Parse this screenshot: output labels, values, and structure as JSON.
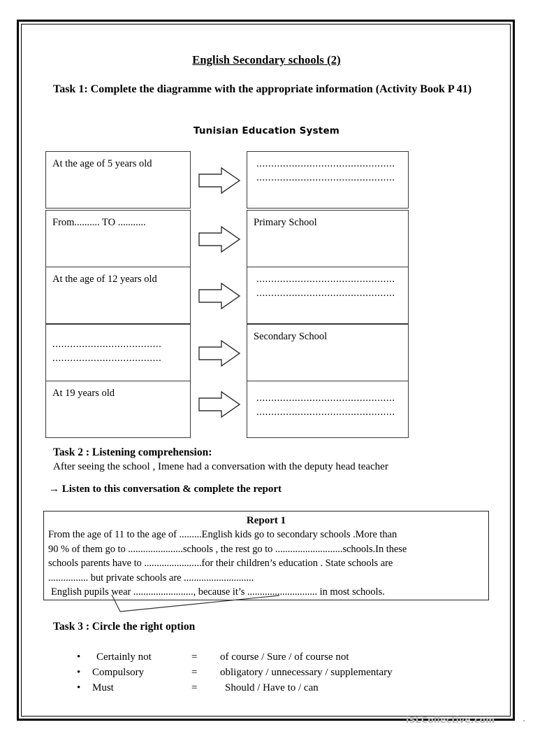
{
  "document": {
    "title": "English Secondary schools (2)",
    "watermark": "iSLCollective.com"
  },
  "task1": {
    "heading": "Task 1: Complete the diagramme with the appropriate information (Activity Book P 41)",
    "diagram_caption": "Tunisian Education System",
    "arrow_icon": "right-arrow-icon",
    "rows": [
      {
        "left": "At the age of 5 years old",
        "left_dots": [],
        "right": "",
        "right_dots": [
          "...............................................",
          "..............................................."
        ]
      },
      {
        "left": "From.......... TO ...........",
        "left_dots": [],
        "right": "Primary School",
        "right_dots": []
      },
      {
        "left": "At the age of 12 years old",
        "left_dots": [],
        "right": "",
        "right_dots": [
          "...............................................",
          "..............................................."
        ]
      },
      {
        "left": "",
        "left_dots": [
          ".....................................",
          "....................................."
        ],
        "right": "Secondary School",
        "right_dots": []
      },
      {
        "left": "At 19 years old",
        "left_dots": [],
        "right": "",
        "right_dots": [
          "...............................................",
          "..............................................."
        ]
      }
    ]
  },
  "task2": {
    "heading": "Task 2  : Listening comprehension:",
    "subtitle": "After seeing the school , Imene had a conversation with the deputy head teacher",
    "instruction": "→ Listen to this conversation & complete the report",
    "report": {
      "title": "Report 1",
      "lines": [
        "From the age of 11 to the age of .........English kids go to secondary schools .More than",
        "90 % of them go to ......................schools , the rest go to ...........................schools.In these",
        "schools parents have to .......................for their children’s education . State schools are",
        "................ but private schools are ............................",
        " English pupils wear ........................, because it’s ............................ in most schools."
      ]
    }
  },
  "task3": {
    "heading": "Task 3 : Circle the right option",
    "bullet": "•",
    "equals": "=",
    "items": [
      {
        "term": "Certainly not",
        "options": "of course  / Sure / of course not"
      },
      {
        "term": "Compulsory",
        "options": "obligatory / unnecessary / supplementary"
      },
      {
        "term": "Must",
        "options": "Should / Have to / can"
      }
    ]
  }
}
